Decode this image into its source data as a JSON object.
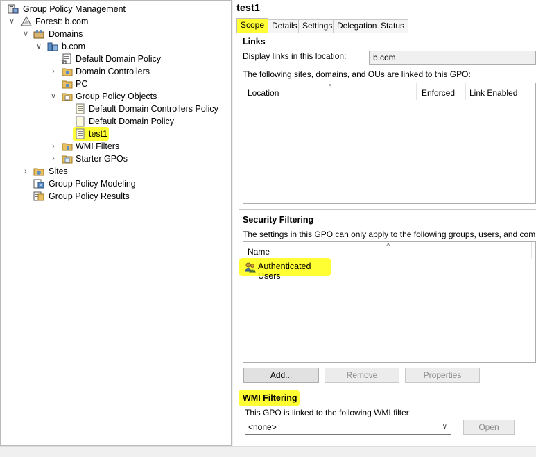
{
  "tree": {
    "root": "Group Policy Management",
    "forest": "Forest: b.com",
    "domains": "Domains",
    "domain": "b.com",
    "default_domain_policy_link": "Default Domain Policy",
    "domain_controllers": "Domain Controllers",
    "pc": "PC",
    "gpo_container": "Group Policy Objects",
    "gpo_dc_policy": "Default Domain Controllers Policy",
    "gpo_domain_policy": "Default Domain Policy",
    "gpo_test1": "test1",
    "wmi_filters": "WMI Filters",
    "starter_gpos": "Starter GPOs",
    "sites": "Sites",
    "modeling": "Group Policy Modeling",
    "results": "Group Policy Results"
  },
  "detail": {
    "title": "test1",
    "tabs": [
      "Scope",
      "Details",
      "Settings",
      "Delegation",
      "Status"
    ],
    "active_tab": "Scope",
    "links": {
      "heading": "Links",
      "location_label": "Display links in this location:",
      "location_value": "b.com",
      "description": "The following sites, domains, and OUs are linked to this GPO:",
      "columns": [
        "Location",
        "Enforced",
        "Link Enabled"
      ]
    },
    "security": {
      "heading": "Security Filtering",
      "description": "The settings in this GPO can only apply to the following groups, users, and computers:",
      "column": "Name",
      "entries": [
        "Authenticated Users"
      ],
      "add_label": "Add...",
      "remove_label": "Remove",
      "properties_label": "Properties"
    },
    "wmi": {
      "heading": "WMI Filtering",
      "description": "This GPO is linked to the following WMI filter:",
      "selected": "<none>",
      "open_label": "Open"
    }
  },
  "colors": {
    "highlight": "#ffff33",
    "border": "#adadad"
  }
}
